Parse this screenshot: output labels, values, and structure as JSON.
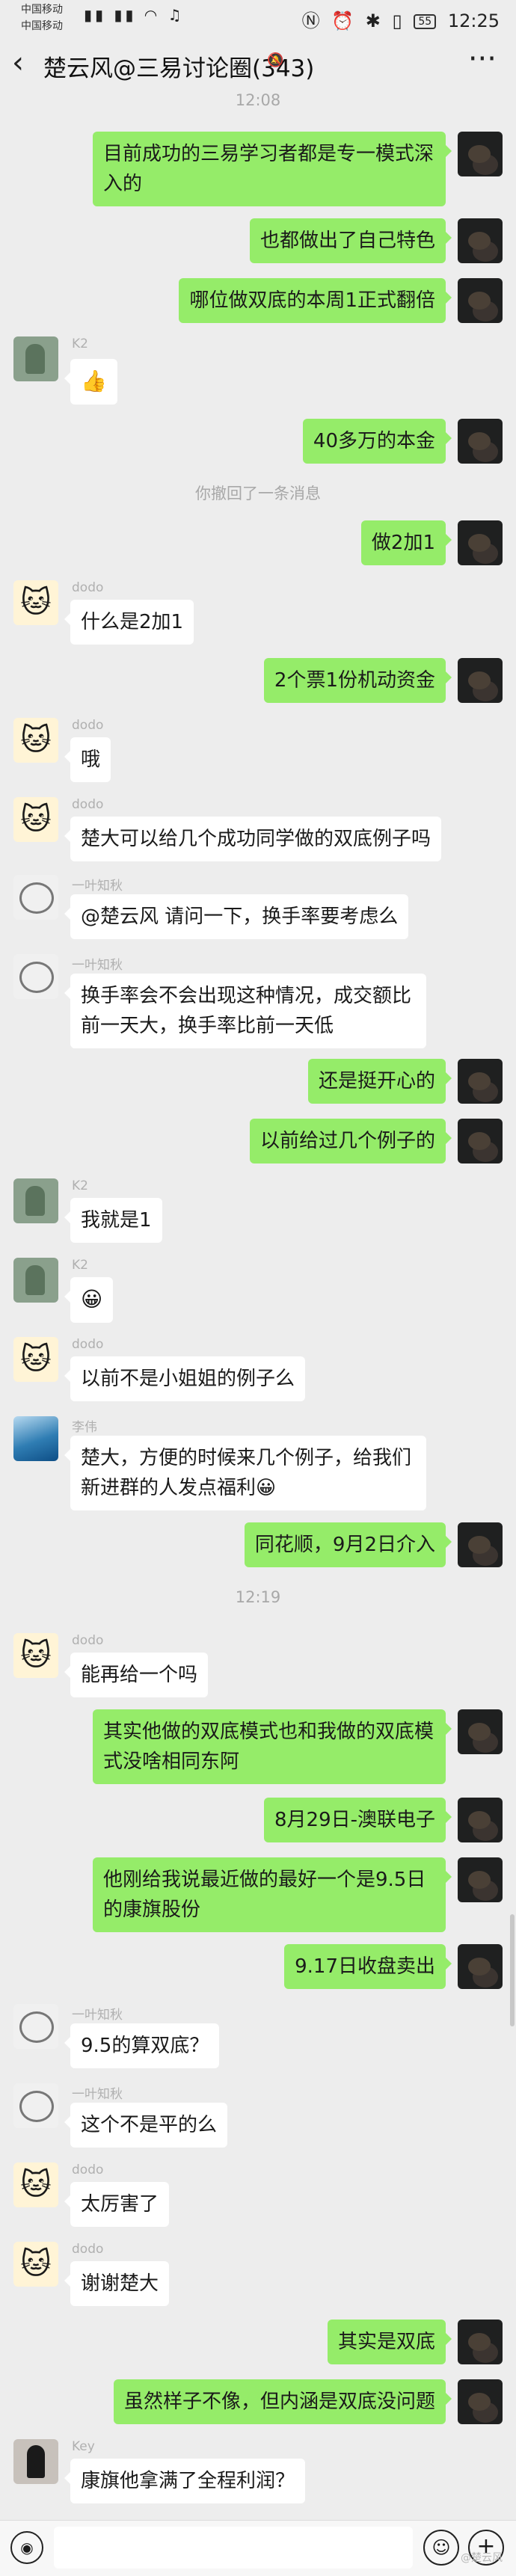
{
  "status_bar": {
    "carrier1": "中国移动",
    "carrier2": "中国移动",
    "time": "12:25",
    "battery": "55"
  },
  "header": {
    "back_icon": "chevron-left-icon",
    "title": "楚云风@三易讨论圈(343)",
    "mute_icon": "mute-icon",
    "more_icon": "more-icon"
  },
  "timestamps": [
    "12:08",
    "12:19"
  ],
  "system_message": "你撤回了一条消息",
  "messages": [
    {
      "side": "right",
      "text": "目前成功的三易学习者都是专一模式深入的"
    },
    {
      "side": "right",
      "text": "也都做出了自己特色"
    },
    {
      "side": "right",
      "text": "哪位做双底的本周1正式翻倍"
    },
    {
      "side": "left",
      "sender": "K2",
      "text": "👍"
    },
    {
      "side": "right",
      "text": "40多万的本金"
    },
    {
      "side": "right",
      "text": "做2加1"
    },
    {
      "side": "left",
      "sender": "dodo",
      "text": "什么是2加1"
    },
    {
      "side": "right",
      "text": "2个票1份机动资金"
    },
    {
      "side": "left",
      "sender": "dodo",
      "text": "哦"
    },
    {
      "side": "left",
      "sender": "dodo",
      "text": "楚大可以给几个成功同学做的双底例子吗"
    },
    {
      "side": "left",
      "sender": "一叶知秋",
      "text": "@楚云风  请问一下，换手率要考虑么"
    },
    {
      "side": "left",
      "sender": "一叶知秋",
      "text": "换手率会不会出现这种情况，成交额比前一天大，换手率比前一天低"
    },
    {
      "side": "right",
      "text": "还是挺开心的"
    },
    {
      "side": "right",
      "text": "以前给过几个例子的"
    },
    {
      "side": "left",
      "sender": "K2",
      "text": "我就是1"
    },
    {
      "side": "left",
      "sender": "K2",
      "text": "😀"
    },
    {
      "side": "left",
      "sender": "dodo",
      "text": "以前不是小姐姐的例子么"
    },
    {
      "side": "left",
      "sender": "李伟",
      "text": "楚大，方便的时候来几个例子，给我们新进群的人发点福利😀"
    },
    {
      "side": "right",
      "text": "同花顺，9月2日介入"
    },
    {
      "side": "left",
      "sender": "dodo",
      "text": "能再给一个吗"
    },
    {
      "side": "right",
      "text": "其实他做的双底模式也和我做的双底模式没啥相同东阿"
    },
    {
      "side": "right",
      "text": "8月29日-澳联电子"
    },
    {
      "side": "right",
      "text": "他刚给我说最近做的最好一个是9.5日的康旗股份"
    },
    {
      "side": "right",
      "text": "9.17日收盘卖出"
    },
    {
      "side": "left",
      "sender": "一叶知秋",
      "text": "9.5的算双底？"
    },
    {
      "side": "left",
      "sender": "一叶知秋",
      "text": "这个不是平的么"
    },
    {
      "side": "left",
      "sender": "dodo",
      "text": "太厉害了"
    },
    {
      "side": "left",
      "sender": "dodo",
      "text": "谢谢楚大"
    },
    {
      "side": "right",
      "text": "其实是双底"
    },
    {
      "side": "right",
      "text": "虽然样子不像，但内涵是双底没问题"
    },
    {
      "side": "left",
      "sender": "Key",
      "text": "康旗他拿满了全程利润？"
    }
  ],
  "input_bar": {
    "voice_icon": "voice-icon",
    "emoji_icon": "emoji-icon",
    "plus_icon": "plus-icon"
  },
  "watermark": "@楚云风"
}
